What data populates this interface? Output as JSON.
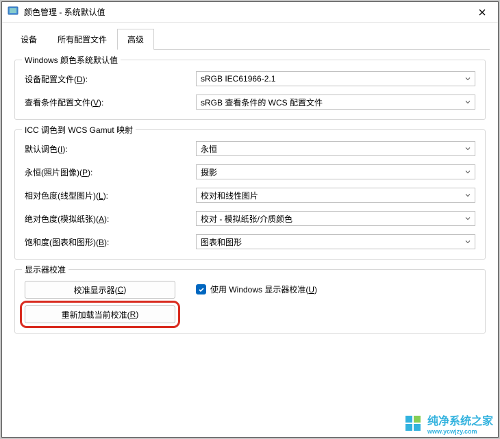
{
  "titlebar": {
    "title": "颜色管理 - 系统默认值"
  },
  "tabs": {
    "device": "设备",
    "profiles": "所有配置文件",
    "advanced": "高级"
  },
  "group1": {
    "legend": "Windows 颜色系统默认值",
    "deviceProfileLabel": "设备配置文件(",
    "deviceProfileKey": "D",
    "deviceProfileAfter": "):",
    "deviceProfileValue": "sRGB IEC61966-2.1",
    "viewCondLabel": "查看条件配置文件(",
    "viewCondKey": "V",
    "viewCondAfter": "):",
    "viewCondValue": "sRGB 查看条件的 WCS 配置文件"
  },
  "group2": {
    "legend": "ICC 调色到 WCS Gamut 映射",
    "defaultLabel": "默认调色(",
    "defaultKey": "I",
    "defaultAfter": "):",
    "defaultValue": "永恒",
    "permanentLabel": "永恒(照片图像)(",
    "permanentKey": "P",
    "permanentAfter": "):",
    "permanentValue": "摄影",
    "relativeLabel": "相对色度(线型图片)(",
    "relativeKey": "L",
    "relativeAfter": "):",
    "relativeValue": "校对和线性图片",
    "absoluteLabel": "绝对色度(模拟纸张)(",
    "absoluteKey": "A",
    "absoluteAfter": "):",
    "absoluteValue": "校对 - 模拟纸张/介质颜色",
    "saturationLabel": "饱和度(图表和图形)(",
    "saturationKey": "B",
    "saturationAfter": "):",
    "saturationValue": "图表和图形"
  },
  "group3": {
    "legend": "显示器校准",
    "calibrateBtn": "校准显示器(",
    "calibrateKey": "C",
    "calibrateAfter": ")",
    "reloadBtn": "重新加载当前校准(",
    "reloadKey": "R",
    "reloadAfter": ")",
    "useWinCalib": "使用 Windows 显示器校准(",
    "useWinCalibKey": "U",
    "useWinCalibAfter": ")"
  },
  "watermark": {
    "text": "纯净系统之家",
    "url": "www.ycwjzy.com"
  }
}
